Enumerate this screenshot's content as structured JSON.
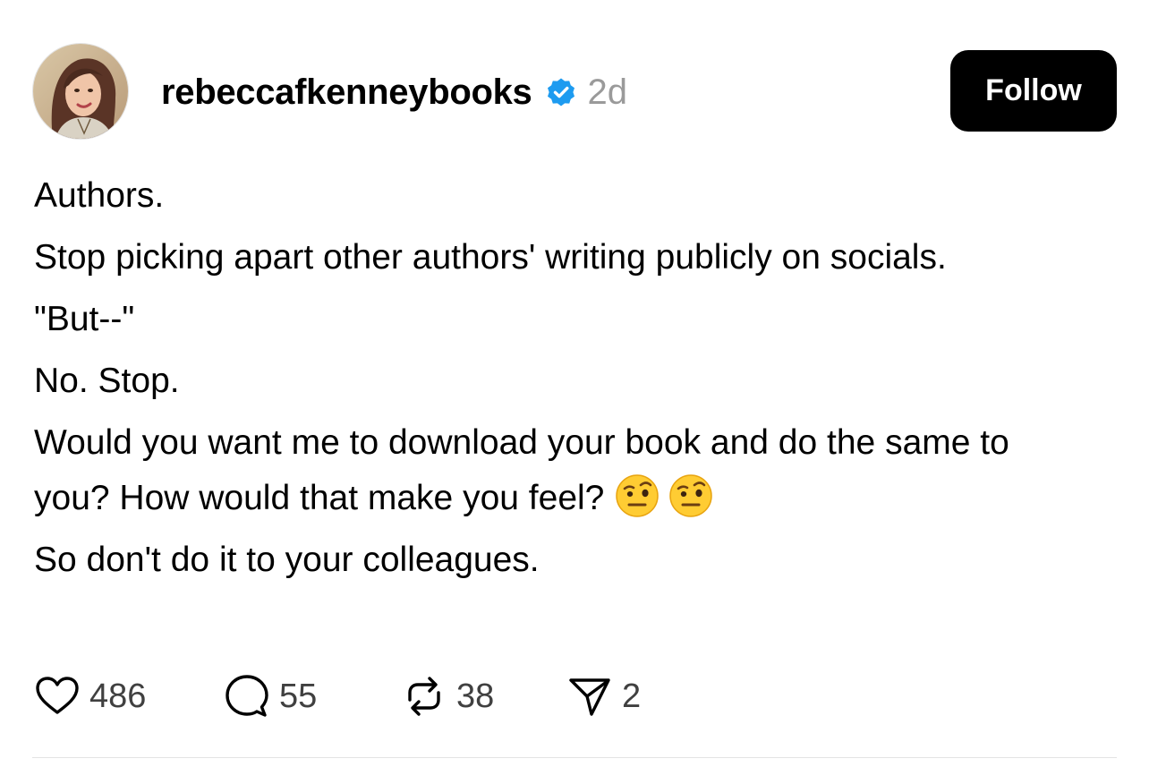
{
  "post": {
    "username": "rebeccafkenneybooks",
    "verified": true,
    "time_ago": "2d",
    "follow_label": "Follow",
    "paragraphs": [
      "Authors.",
      "Stop picking apart other authors' writing publicly on socials.",
      "\"But--\"",
      "No. Stop.",
      "Would you want me to download your book and do the same to you? How would that make you feel?",
      "So don't do it to your colleagues."
    ],
    "emojis": [
      "face-with-raised-eyebrow",
      "face-with-raised-eyebrow"
    ]
  },
  "actions": {
    "likes": "486",
    "comments": "55",
    "reposts": "38",
    "shares": "2"
  },
  "colors": {
    "follow_bg": "#000000",
    "verified_blue": "#1d9bf0",
    "muted_text": "#9a9a9a"
  }
}
